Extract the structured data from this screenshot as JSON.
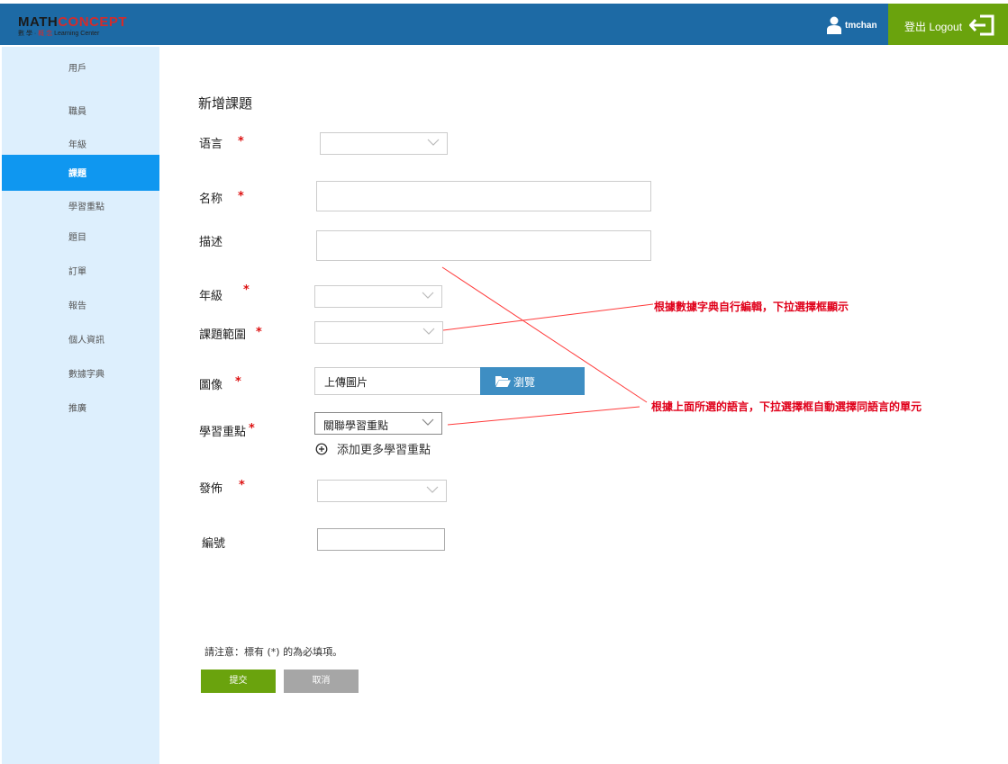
{
  "header": {
    "logo_main_a": "MATH",
    "logo_main_b": "CONCEPT",
    "logo_sub_a": "數 學 ·",
    "logo_sub_b": " 概 念 ",
    "logo_sub_c": "Learning Center",
    "username": "tmchan",
    "logout_label": "登出 Logout"
  },
  "sidebar": {
    "items": [
      {
        "label": "用戶"
      },
      {
        "label": "職員"
      },
      {
        "label": "年級"
      },
      {
        "label": "課題"
      },
      {
        "label": "學習重點"
      },
      {
        "label": "題目"
      },
      {
        "label": "訂單"
      },
      {
        "label": "報告"
      },
      {
        "label": "個人資訊"
      },
      {
        "label": "數據字典"
      },
      {
        "label": "推廣"
      }
    ],
    "active": "課題"
  },
  "form": {
    "title": "新增課題",
    "required_mark": "*",
    "fields": {
      "language": {
        "label": "语言",
        "value": ""
      },
      "name": {
        "label": "名称",
        "value": ""
      },
      "description": {
        "label": "描述",
        "value": ""
      },
      "grade": {
        "label": "年級",
        "value": ""
      },
      "topic_scope": {
        "label": "課題範圍",
        "value": ""
      },
      "image": {
        "label": "圖像",
        "upload_text": "上傳圖片",
        "browse_label": "瀏覽"
      },
      "learning_focus": {
        "label": "學習重點",
        "value": "關聯學習重點",
        "add_more": "添加更多學習重點"
      },
      "publish": {
        "label": "發佈",
        "value": ""
      },
      "code": {
        "label": "編號",
        "value": ""
      }
    },
    "note": "請注意：標有 (*) 的為必填項。",
    "submit_label": "提交",
    "cancel_label": "取消"
  },
  "annotations": {
    "note1": "根據數據字典自行編輯，下拉選擇框顯示",
    "note2": "根據上面所選的語言，下拉選擇框自動選擇同語言的單元"
  },
  "colors": {
    "header": "#1d6aa5",
    "logout": "#6aa30d",
    "sidebar": "#ddeffd",
    "sidebar_active": "#0f97f0",
    "browse": "#3e8ec3",
    "submit": "#6aa30d",
    "cancel": "#a6a6a6",
    "annotation": "#e0001a"
  }
}
